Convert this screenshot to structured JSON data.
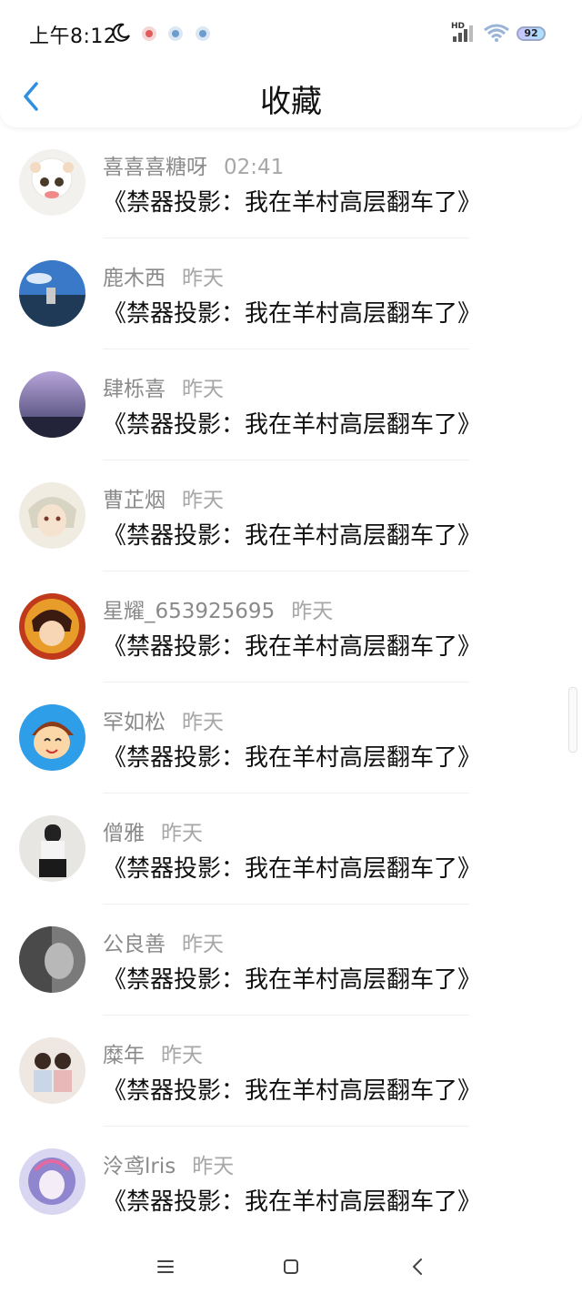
{
  "status_bar": {
    "time": "上午8:12",
    "network": "HD",
    "battery": "92"
  },
  "header": {
    "title": "收藏"
  },
  "favorites": [
    {
      "name": "喜喜喜糖呀",
      "time": "02:41",
      "title": "《禁器投影：我在羊村高层翻车了》"
    },
    {
      "name": "鹿木西",
      "time": "昨天",
      "title": "《禁器投影：我在羊村高层翻车了》"
    },
    {
      "name": "肆栎喜",
      "time": "昨天",
      "title": "《禁器投影：我在羊村高层翻车了》"
    },
    {
      "name": "曹芷烟",
      "time": "昨天",
      "title": "《禁器投影：我在羊村高层翻车了》"
    },
    {
      "name": "星耀_653925695",
      "time": "昨天",
      "title": "《禁器投影：我在羊村高层翻车了》"
    },
    {
      "name": "罕如松",
      "time": "昨天",
      "title": "《禁器投影：我在羊村高层翻车了》"
    },
    {
      "name": "僧雅",
      "time": "昨天",
      "title": "《禁器投影：我在羊村高层翻车了》"
    },
    {
      "name": "公良善",
      "time": "昨天",
      "title": "《禁器投影：我在羊村高层翻车了》"
    },
    {
      "name": "糜年",
      "time": "昨天",
      "title": "《禁器投影：我在羊村高层翻车了》"
    },
    {
      "name": "泠鸢lris",
      "time": "昨天",
      "title": "《禁器投影：我在羊村高层翻车了》"
    }
  ],
  "colors": {
    "accent": "#2f8fe0",
    "name_text": "#8a8a8a",
    "title_text": "#111111"
  }
}
